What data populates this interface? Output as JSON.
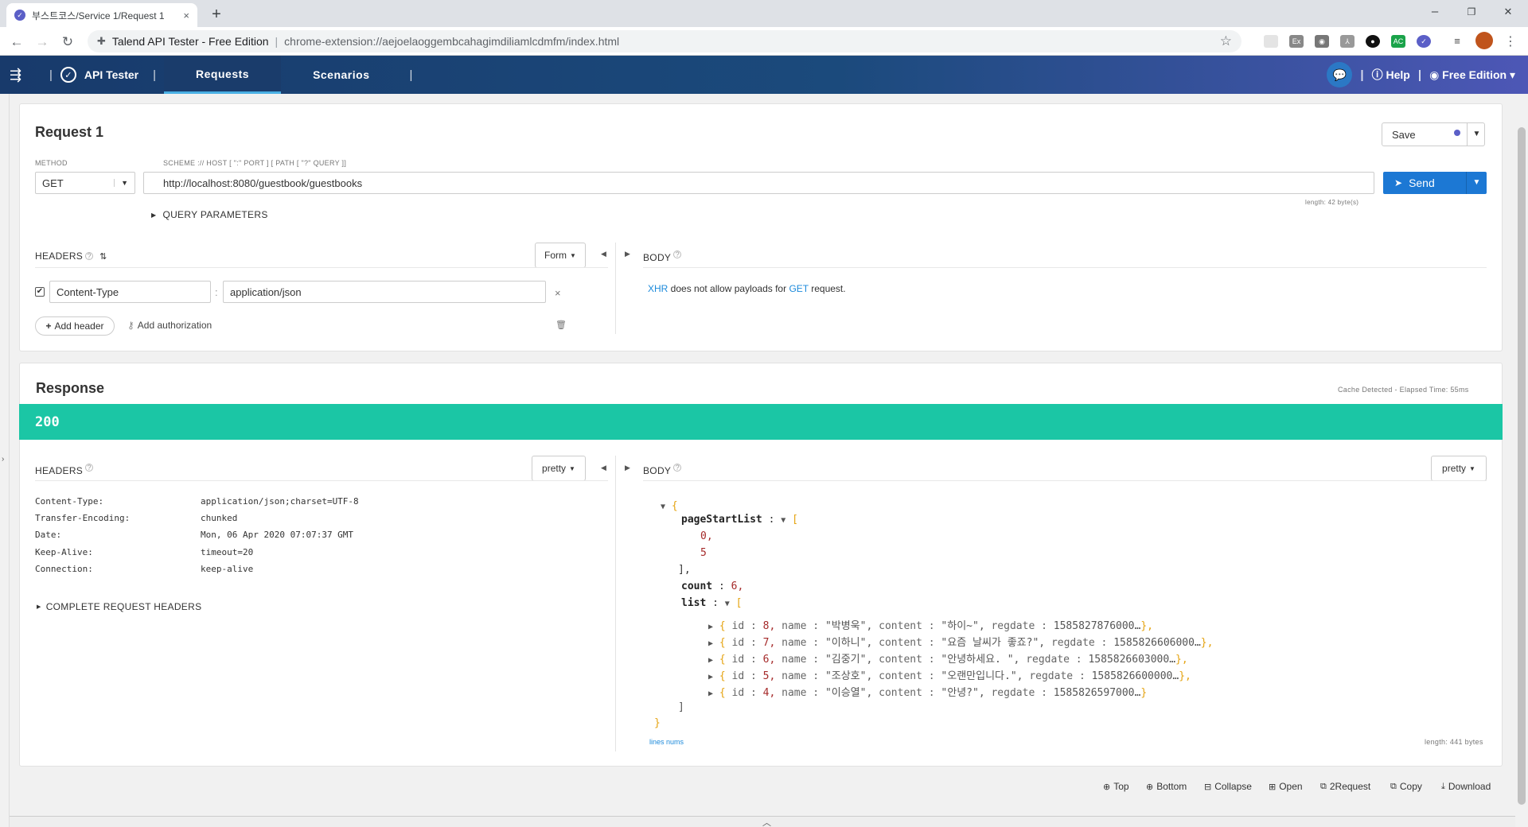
{
  "browser": {
    "tab_title": "부스트코스/Service 1/Request 1",
    "new_tab": "+",
    "close_tab": "×",
    "window_controls": [
      "–",
      "❐",
      "✕"
    ],
    "site_name": "Talend API Tester - Free Edition",
    "url": "chrome-extension://aejoelaoggembcahagimdiliamlcdmfm/index.html"
  },
  "appnav": {
    "brand": "API Tester",
    "tabs": [
      {
        "label": "Requests",
        "active": true
      },
      {
        "label": "Scenarios",
        "active": false
      }
    ],
    "help": "Help",
    "edition": "Free Edition"
  },
  "request": {
    "title": "Request 1",
    "save": "Save",
    "method_label": "METHOD",
    "method": "GET",
    "scheme_label": "SCHEME :// HOST [ \":\" PORT ] [ PATH [ \"?\" QUERY ]]",
    "url": "http://localhost:8080/guestbook/guestbooks",
    "send": "Send",
    "length": "length: 42 byte(s)",
    "query_params": "QUERY PARAMETERS",
    "headers_label": "HEADERS",
    "form_select": "Form",
    "header_name": "Content-Type",
    "header_value": "application/json",
    "add_header": "Add header",
    "add_auth": "Add authorization",
    "body_label": "BODY",
    "body_msg_a": "XHR",
    "body_msg_b": " does not allow payloads for ",
    "body_msg_c": "GET",
    "body_msg_d": " request."
  },
  "response": {
    "title": "Response",
    "cache": "Cache Detected - Elapsed Time: 55ms",
    "status": "200",
    "status_color": "#1bc6a5",
    "headers_label": "HEADERS",
    "pretty": "pretty",
    "body_label": "BODY",
    "headers": [
      {
        "k": "Content-Type:",
        "v": "application/json;charset=UTF-8"
      },
      {
        "k": "Transfer-Encoding:",
        "v": "chunked"
      },
      {
        "k": "Date:",
        "v": "Mon, 06 Apr 2020 07:07:37 GMT"
      },
      {
        "k": "Keep-Alive:",
        "v": "timeout=20"
      },
      {
        "k": "Connection:",
        "v": "keep-alive"
      }
    ],
    "complete_headers": "COMPLETE REQUEST HEADERS",
    "body": {
      "open": "{",
      "pageStartList_key": "pageStartList",
      "pageStartList": [
        "0,",
        "5"
      ],
      "close_arr": "],",
      "count_key": "count",
      "count": "6,",
      "list_key": "list",
      "list": [
        {
          "id": "8,",
          "name": "\"박병욱\",",
          "content": "\"하이~\",",
          "regdate": "1585827876000…",
          "tail": "},"
        },
        {
          "id": "7,",
          "name": "\"이하니\",",
          "content": "\"요즘 날씨가 좋죠?\",",
          "regdate": "1585826606000…",
          "tail": "},"
        },
        {
          "id": "6,",
          "name": "\"김중기\",",
          "content": "\"안녕하세요. \",",
          "regdate": "1585826603000…",
          "tail": "},"
        },
        {
          "id": "5,",
          "name": "\"조상호\",",
          "content": "\"오랜만입니다.\",",
          "regdate": "1585826600000…",
          "tail": "},"
        },
        {
          "id": "4,",
          "name": "\"이승열\",",
          "content": "\"안녕?\",",
          "regdate": "1585826597000…",
          "tail": "}"
        }
      ],
      "close_list": "]",
      "close": "}"
    },
    "lines_nums": "lines nums",
    "length": "length: 441 bytes"
  },
  "footer": [
    "Top",
    "Bottom",
    "Collapse",
    "Open",
    "2Request",
    "Copy",
    "Download"
  ]
}
